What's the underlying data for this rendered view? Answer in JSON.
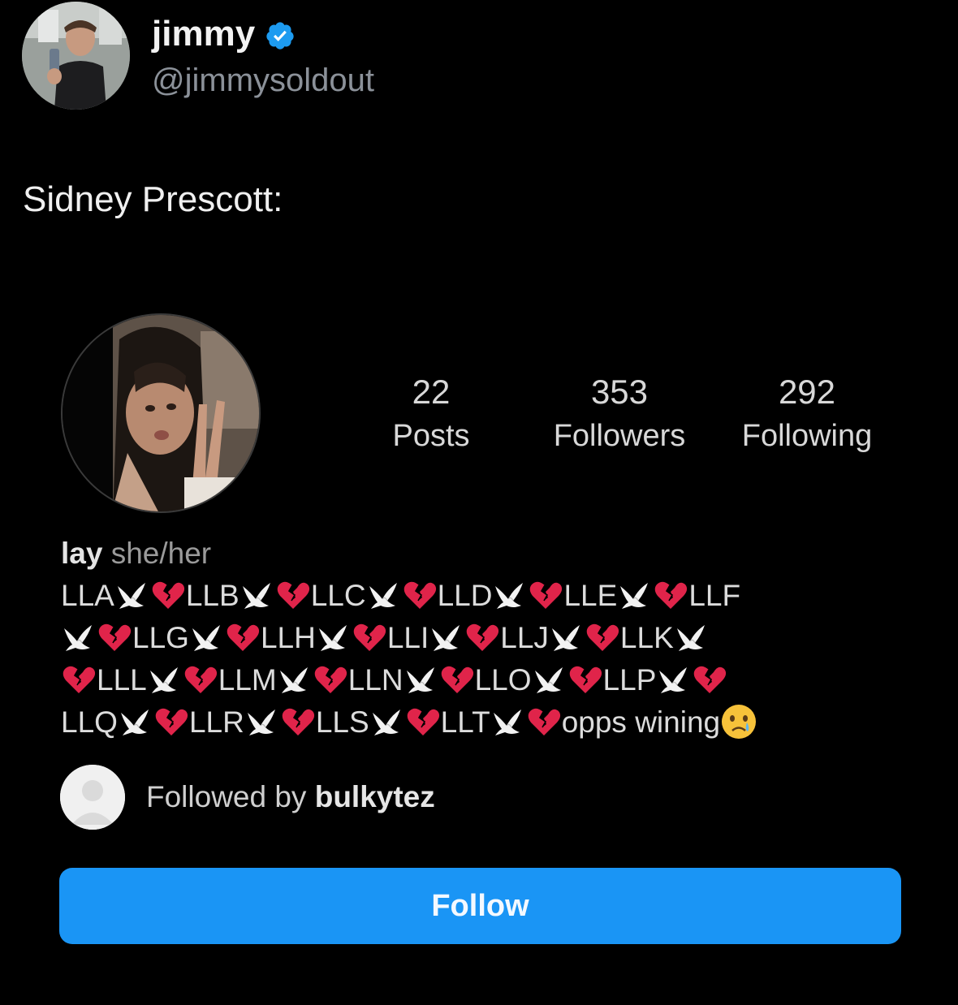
{
  "tweet": {
    "display_name": "jimmy",
    "handle": "@jimmysoldout",
    "verified": true,
    "text": "Sidney Prescott:"
  },
  "profile": {
    "stats": {
      "posts_value": "22",
      "posts_label": "Posts",
      "followers_value": "353",
      "followers_label": "Followers",
      "following_value": "292",
      "following_label": "Following"
    },
    "name": "lay",
    "pronouns": "she/her",
    "bio_lines": [
      [
        {
          "t": "LLA"
        },
        {
          "e": "dove"
        },
        {
          "e": "heart"
        },
        {
          "t": "LLB"
        },
        {
          "e": "dove"
        },
        {
          "e": "heart"
        },
        {
          "t": "LLC"
        },
        {
          "e": "dove"
        },
        {
          "e": "heart"
        },
        {
          "t": "LLD"
        },
        {
          "e": "dove"
        },
        {
          "e": "heart"
        },
        {
          "t": "LLE"
        },
        {
          "e": "dove"
        },
        {
          "e": "heart"
        },
        {
          "t": "LLF"
        }
      ],
      [
        {
          "e": "dove"
        },
        {
          "e": "heart"
        },
        {
          "t": "LLG"
        },
        {
          "e": "dove"
        },
        {
          "e": "heart"
        },
        {
          "t": "LLH"
        },
        {
          "e": "dove"
        },
        {
          "e": "heart"
        },
        {
          "t": "LLI"
        },
        {
          "e": "dove"
        },
        {
          "e": "heart"
        },
        {
          "t": "LLJ"
        },
        {
          "e": "dove"
        },
        {
          "e": "heart"
        },
        {
          "t": "LLK"
        },
        {
          "e": "dove"
        }
      ],
      [
        {
          "e": "heart"
        },
        {
          "t": "LLL"
        },
        {
          "e": "dove"
        },
        {
          "e": "heart"
        },
        {
          "t": "LLM"
        },
        {
          "e": "dove"
        },
        {
          "e": "heart"
        },
        {
          "t": "LLN"
        },
        {
          "e": "dove"
        },
        {
          "e": "heart"
        },
        {
          "t": "LLO"
        },
        {
          "e": "dove"
        },
        {
          "e": "heart"
        },
        {
          "t": "LLP"
        },
        {
          "e": "dove"
        },
        {
          "e": "heart"
        }
      ],
      [
        {
          "t": "LLQ"
        },
        {
          "e": "dove"
        },
        {
          "e": "heart"
        },
        {
          "t": "LLR"
        },
        {
          "e": "dove"
        },
        {
          "e": "heart"
        },
        {
          "t": "LLS"
        },
        {
          "e": "dove"
        },
        {
          "e": "heart"
        },
        {
          "t": "LLT"
        },
        {
          "e": "dove"
        },
        {
          "e": "heart"
        },
        {
          "t": "opps wining"
        },
        {
          "e": "crying-face"
        }
      ]
    ],
    "followed_by_prefix": "Followed by",
    "followed_by_user": "bulkytez",
    "follow_button_label": "Follow"
  },
  "colors": {
    "background": "#000000",
    "follow_button": "#1a95f5",
    "verified_badge": "#1d9bf0",
    "broken_heart": "#e0244a"
  }
}
